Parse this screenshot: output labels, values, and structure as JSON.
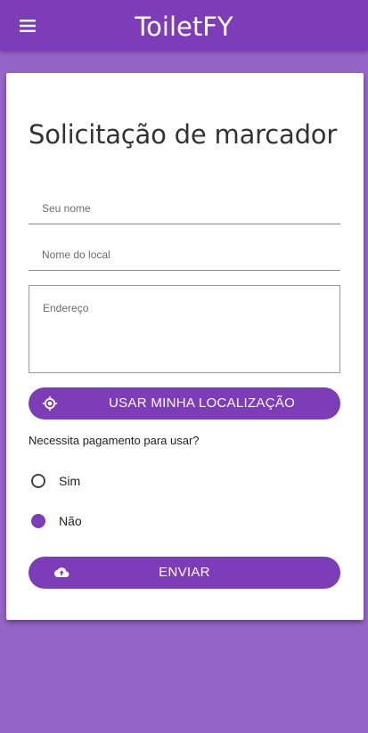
{
  "app": {
    "title": "ToiletFY",
    "menu_icon": "hamburger-menu-icon"
  },
  "colors": {
    "primary": "#7d3cb8",
    "page_background": "#9466c9",
    "card": "#ffffff"
  },
  "form": {
    "title": "Solicitação de marcador",
    "name_field": {
      "placeholder": "Seu nome",
      "value": ""
    },
    "place_field": {
      "placeholder": "Nome do local",
      "value": ""
    },
    "address_field": {
      "placeholder": "Endereço",
      "value": ""
    },
    "location_button": {
      "label": "USAR MINHA LOCALIZAÇÃO",
      "icon": "gps-location-icon"
    },
    "payment_question": "Necessita pagamento para usar?",
    "payment_options": [
      {
        "label": "Sim",
        "selected": false
      },
      {
        "label": "Não",
        "selected": true
      }
    ],
    "submit_button": {
      "label": "ENVIAR",
      "icon": "cloud-upload-icon"
    }
  }
}
